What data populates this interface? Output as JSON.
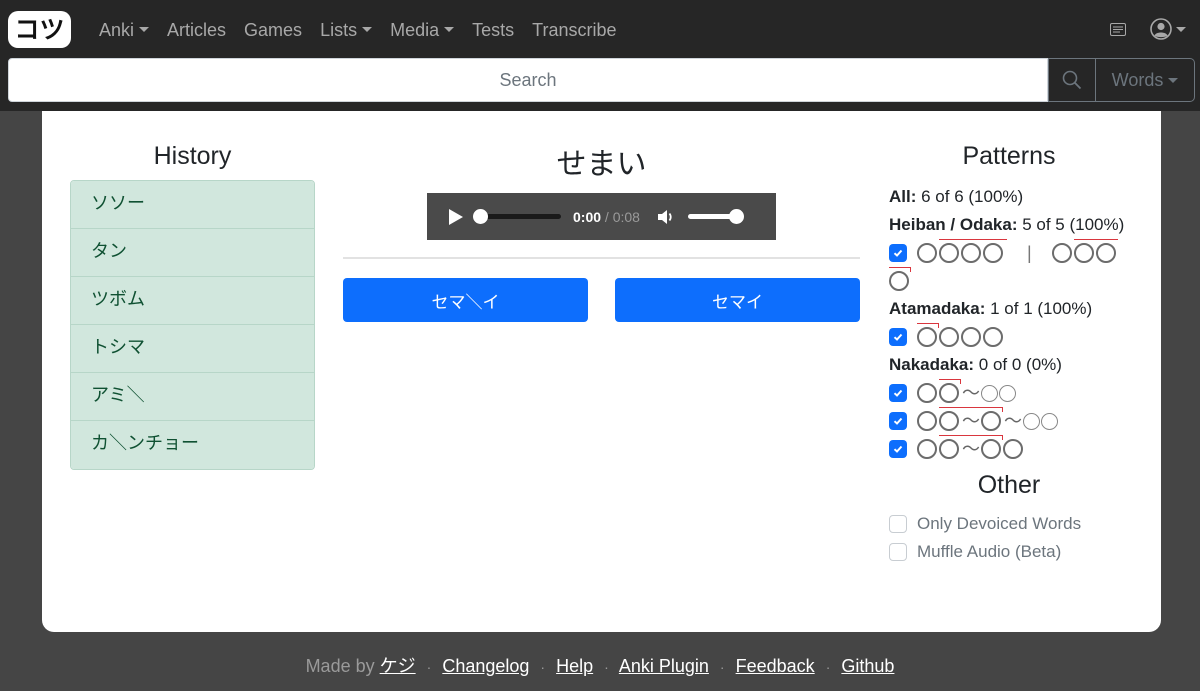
{
  "navbar": {
    "brand": "コツ",
    "links": [
      {
        "label": "Anki",
        "dropdown": true
      },
      {
        "label": "Articles",
        "dropdown": false
      },
      {
        "label": "Games",
        "dropdown": false
      },
      {
        "label": "Lists",
        "dropdown": true
      },
      {
        "label": "Media",
        "dropdown": true
      },
      {
        "label": "Tests",
        "dropdown": false
      },
      {
        "label": "Transcribe",
        "dropdown": false
      }
    ],
    "right_icons": [
      "news-icon",
      "user-icon"
    ]
  },
  "search": {
    "placeholder": "Search",
    "value": "",
    "mode_label": "Words"
  },
  "history": {
    "title": "History",
    "items": [
      "ソソー",
      "タン",
      "ツボム",
      "トシマ",
      "アミ＼",
      "カ＼ンチョー"
    ]
  },
  "quiz": {
    "word": "せまい",
    "audio": {
      "current": "0:00",
      "separator": " / ",
      "duration": "0:08",
      "progress": 0,
      "volume": 1.0
    },
    "answers": [
      "セマ＼イ",
      "セマイ"
    ]
  },
  "patterns": {
    "title": "Patterns",
    "all": {
      "label": "All:",
      "value": "6 of 6 (100%)"
    },
    "heiban": {
      "label": "Heiban / Odaka:",
      "value": "5 of 5 (100%)",
      "checked": true,
      "separator": "|"
    },
    "atamadaka": {
      "label": "Atamadaka:",
      "value": "1 of 1 (100%)",
      "checked": true
    },
    "nakadaka": {
      "label": "Nakadaka:",
      "value": "0 of 0 (0%)",
      "options": [
        {
          "checked": true
        },
        {
          "checked": true
        },
        {
          "checked": true
        }
      ]
    },
    "tilde": "〜"
  },
  "other": {
    "title": "Other",
    "options": [
      {
        "label": "Only Devoiced Words",
        "checked": false
      },
      {
        "label": "Muffle Audio (Beta)",
        "checked": false
      }
    ]
  },
  "footer": {
    "made_by": "Made by",
    "author": "ケジ",
    "separator": "·",
    "links": [
      "Changelog",
      "Help",
      "Anki Plugin",
      "Feedback",
      "Github"
    ]
  }
}
